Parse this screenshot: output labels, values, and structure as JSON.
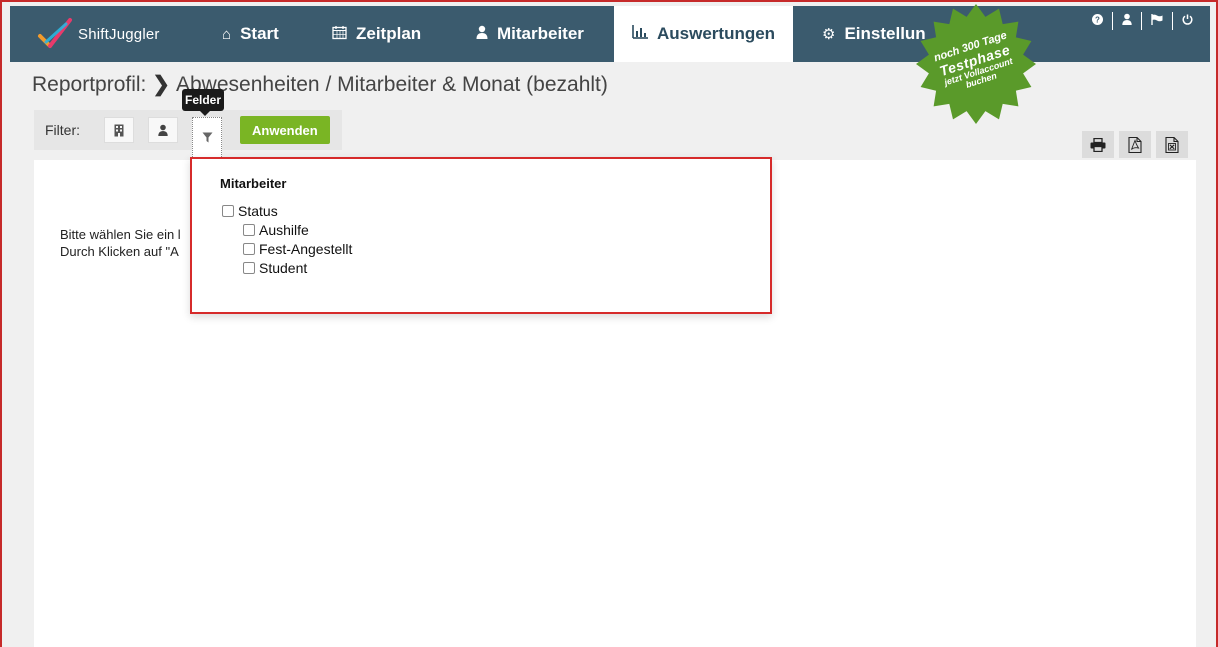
{
  "nav": {
    "logo_text": "ShiftJuggler",
    "items": [
      {
        "label": "Start",
        "icon": "home-icon"
      },
      {
        "label": "Zeitplan",
        "icon": "calendar-icon"
      },
      {
        "label": "Mitarbeiter",
        "icon": "user-icon"
      },
      {
        "label": "Auswertungen",
        "icon": "bar-chart-icon",
        "active": true
      },
      {
        "label": "Einstellun",
        "icon": "gear-icon"
      }
    ],
    "right_icons": [
      "help-icon",
      "user-icon",
      "flag-icon",
      "power-icon"
    ]
  },
  "badge": {
    "line1": "noch 300 Tage",
    "line2": "Testphase",
    "line3": "jetzt Vollaccount",
    "line4": "buchen",
    "color": "#5a9a2a"
  },
  "page": {
    "title_prefix": "Reportprofil:",
    "title": "Abwesenheiten / Mitarbeiter & Monat (bezahlt)"
  },
  "filter": {
    "label": "Filter:",
    "apply_label": "Anwenden",
    "tooltip": "Felder",
    "buttons": [
      "building-icon",
      "user-icon",
      "funnel-icon"
    ]
  },
  "export_icons": [
    "print-icon",
    "pdf-icon",
    "excel-icon"
  ],
  "message": {
    "line1": "Bitte wählen Sie ein l",
    "line2": "Durch Klicken auf \"A"
  },
  "dropdown": {
    "heading": "Mitarbeiter",
    "group_label": "Status",
    "options": [
      "Aushilfe",
      "Fest-Angestellt",
      "Student"
    ]
  },
  "colors": {
    "nav_bg": "#3b5b6e",
    "apply_green": "#7ab524",
    "highlight_red": "#d62b2b"
  }
}
